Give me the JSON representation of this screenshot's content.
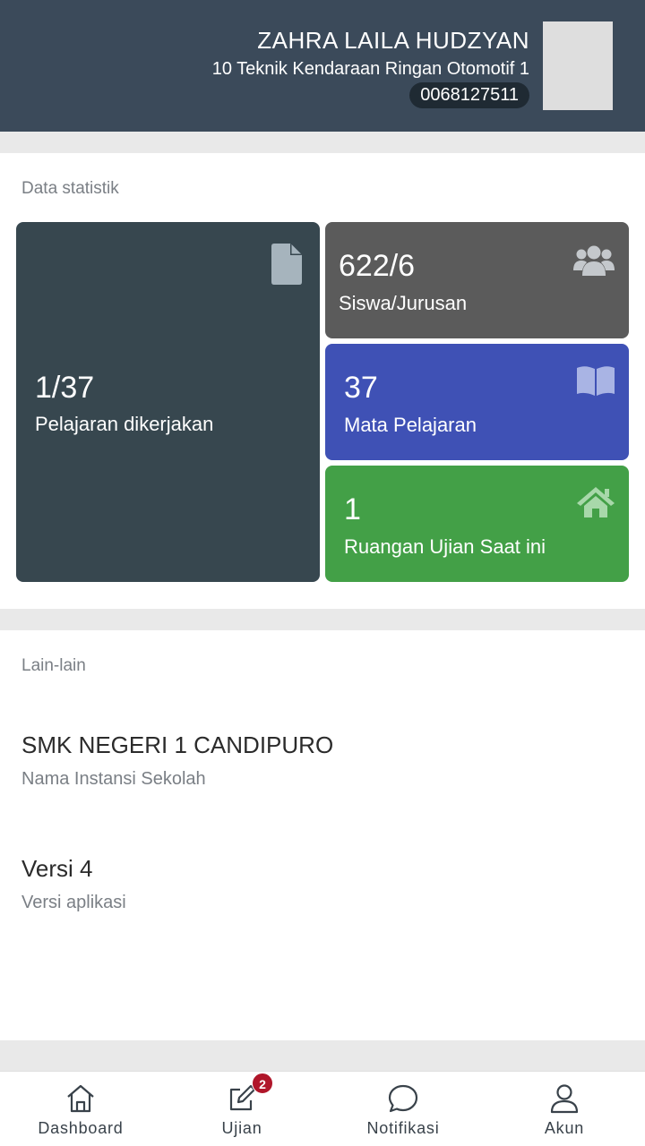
{
  "profile": {
    "name": "ZAHRA LAILA HUDZYAN",
    "class_name": "10 Teknik Kendaraan Ringan Otomotif 1",
    "student_id": "0068127511"
  },
  "stats": {
    "section_label": "Data statistik",
    "cards": {
      "lessons_done": {
        "value": "1/37",
        "caption": "Pelajaran dikerjakan",
        "icon": "file-icon",
        "color": "#37474f"
      },
      "students_majors": {
        "value": "622/6",
        "caption": "Siswa/Jurusan",
        "icon": "users-icon",
        "color": "#5b5b5b"
      },
      "subjects": {
        "value": "37",
        "caption": "Mata Pelajaran",
        "icon": "book-icon",
        "color": "#3f51b5"
      },
      "exam_rooms": {
        "value": "1",
        "caption": "Ruangan Ujian Saat ini",
        "icon": "home-icon",
        "color": "#43a047"
      }
    }
  },
  "other": {
    "section_label": "Lain-lain",
    "school": {
      "title": "SMK NEGERI 1 CANDIPURO",
      "subtitle": "Nama Instansi Sekolah"
    },
    "version": {
      "title": "Versi 4",
      "subtitle": "Versi aplikasi"
    }
  },
  "nav": {
    "items": [
      {
        "label": "Dashboard",
        "icon": "home-outline-icon"
      },
      {
        "label": "Ujian",
        "icon": "edit-icon",
        "badge": "2"
      },
      {
        "label": "Notifikasi",
        "icon": "chat-bubble-icon"
      },
      {
        "label": "Akun",
        "icon": "user-icon"
      }
    ]
  },
  "colors": {
    "header": "#3b4a5a",
    "badge": "#b0162a"
  }
}
